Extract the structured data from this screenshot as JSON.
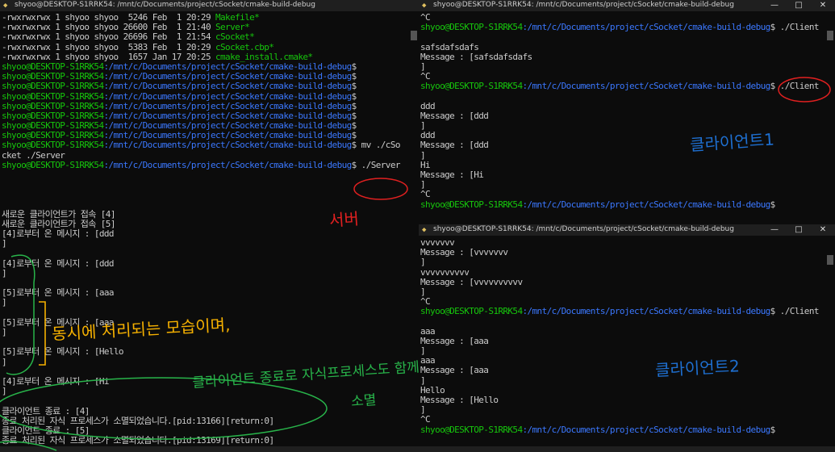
{
  "left_window": {
    "title": "shyoo@DESKTOP-S1RRK54: /mnt/c/Documents/project/cSocket/cmake-build-debug",
    "files": [
      {
        "perm": "-rwxrwxrwx 1 shyoo shyoo  5246 Feb  1 20:29 ",
        "name": "Makefile*"
      },
      {
        "perm": "-rwxrwxrwx 1 shyoo shyoo 26600 Feb  1 21:40 ",
        "name": "Server*"
      },
      {
        "perm": "-rwxrwxrwx 1 shyoo shyoo 26696 Feb  1 21:54 ",
        "name": "cSocket*"
      },
      {
        "perm": "-rwxrwxrwx 1 shyoo shyoo  5383 Feb  1 20:29 ",
        "name": "cSocket.cbp*"
      },
      {
        "perm": "-rwxrwxrwx 1 shyoo shyoo  1657 Jan 17 20:25 ",
        "name": "cmake_install.cmake*"
      }
    ],
    "prompt_user": "shyoo@DESKTOP-S1RRK54",
    "prompt_path": ":/mnt/c/Documents/project/cSocket/cmake-build-debug",
    "empty_prompts": 8,
    "mv_cmd": " mv ./cSo",
    "mv_cont": "cket ./Server",
    "run_cmd": " ./Server",
    "output": [
      "새로운 클라이언트가 접속 [4]",
      "새로운 클라이언트가 접속 [5]",
      "[4]로부터 온 메시지 : [ddd",
      "]",
      "[4]로부터 온 메시지 : [ddd",
      "]",
      "[5]로부터 온 메시지 : [aaa",
      "]",
      "[5]로부터 온 메시지 : [aaa",
      "]",
      "[5]로부터 온 메시지 : [Hello",
      "]",
      "[4]로부터 온 메시지 : [Hi",
      "]",
      "클라이언트 종료 : [4]",
      "종료 처리된 자식 프로세스가 소멸되었습니다.[pid:13166][return:0]",
      "클라이언트 종료 : [5]",
      "종료 처리된 자식 프로세스가 소멸되었습니다.[pid:13169][return:0]"
    ]
  },
  "client1_window": {
    "title": "shyoo@DESKTOP-S1RRK54: /mnt/c/Documents/project/cSocket/cmake-build-debug",
    "lines": [
      {
        "t": "text",
        "v": "^C"
      },
      {
        "t": "prompt",
        "cmd": " ./Client"
      },
      {
        "t": "text",
        "v": ""
      },
      {
        "t": "text",
        "v": "safsdafsdafs"
      },
      {
        "t": "text",
        "v": "Message : [safsdafsdafs"
      },
      {
        "t": "text",
        "v": "]"
      },
      {
        "t": "text",
        "v": "^C"
      },
      {
        "t": "prompt",
        "cmd": " ./Client"
      },
      {
        "t": "text",
        "v": ""
      },
      {
        "t": "text",
        "v": "ddd"
      },
      {
        "t": "text",
        "v": "Message : [ddd"
      },
      {
        "t": "text",
        "v": "]"
      },
      {
        "t": "text",
        "v": "ddd"
      },
      {
        "t": "text",
        "v": "Message : [ddd"
      },
      {
        "t": "text",
        "v": "]"
      },
      {
        "t": "text",
        "v": "Hi"
      },
      {
        "t": "text",
        "v": "Message : [Hi"
      },
      {
        "t": "text",
        "v": "]"
      },
      {
        "t": "text",
        "v": "^C"
      },
      {
        "t": "prompt",
        "cmd": ""
      }
    ]
  },
  "client2_window": {
    "title": "shyoo@DESKTOP-S1RRK54: /mnt/c/Documents/project/cSocket/cmake-build-debug",
    "lines": [
      {
        "t": "text",
        "v": "vvvvvvv"
      },
      {
        "t": "text",
        "v": "Message : [vvvvvvv"
      },
      {
        "t": "text",
        "v": "]"
      },
      {
        "t": "text",
        "v": "vvvvvvvvvv"
      },
      {
        "t": "text",
        "v": "Message : [vvvvvvvvvv"
      },
      {
        "t": "text",
        "v": "]"
      },
      {
        "t": "text",
        "v": "^C"
      },
      {
        "t": "prompt",
        "cmd": " ./Client"
      },
      {
        "t": "text",
        "v": ""
      },
      {
        "t": "text",
        "v": "aaa"
      },
      {
        "t": "text",
        "v": "Message : [aaa"
      },
      {
        "t": "text",
        "v": "]"
      },
      {
        "t": "text",
        "v": "aaa"
      },
      {
        "t": "text",
        "v": "Message : [aaa"
      },
      {
        "t": "text",
        "v": "]"
      },
      {
        "t": "text",
        "v": "Hello"
      },
      {
        "t": "text",
        "v": "Message : [Hello"
      },
      {
        "t": "text",
        "v": "]"
      },
      {
        "t": "text",
        "v": "^C"
      },
      {
        "t": "prompt",
        "cmd": ""
      }
    ]
  },
  "window_buttons": {
    "minimize": "—",
    "maximize": "□",
    "close": "✕"
  },
  "annotations": {
    "server_label": "서버",
    "client1_label": "클라이언트1",
    "client2_label": "클라이언트2",
    "concurrent_note": "동시에 처리되는 모습이며,",
    "cleanup_note": "클라이언트 종료로 자식프로세스도 함께",
    "cleanup_note2": "소멸"
  },
  "colors": {
    "prompt_green": "#16c60c",
    "prompt_blue": "#3b78ff",
    "annot_red": "#e02020",
    "annot_blue": "#1e6fd0",
    "annot_yellow": "#f5b000",
    "annot_green": "#28b44a"
  }
}
